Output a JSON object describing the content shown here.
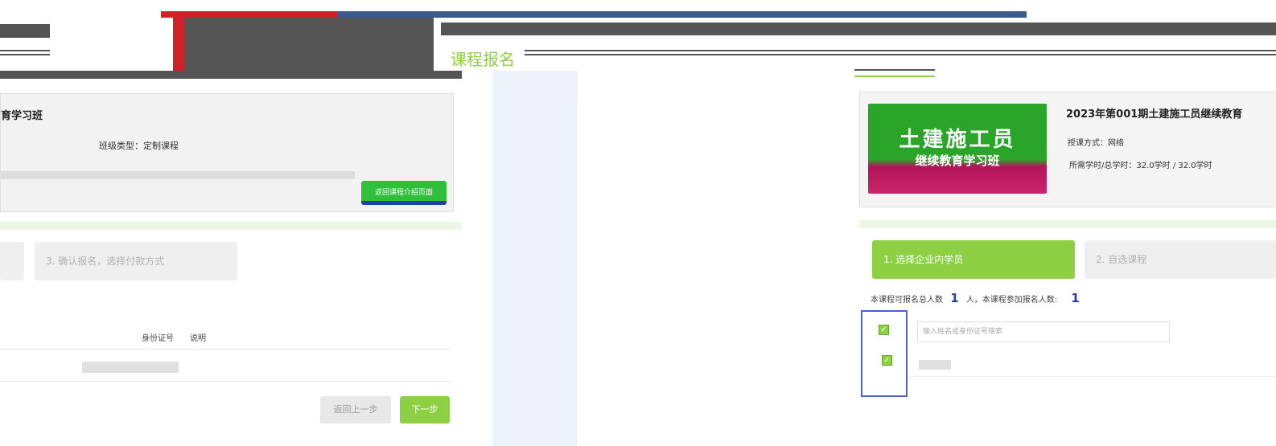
{
  "window_title": "课程报名",
  "left_panel": {
    "class_title_fragment": "育学习班",
    "class_type_label": "班级类型：定制课程",
    "back_to_intro_button": "返回课程介绍页面",
    "step3_label": "3. 确认报名，选择付款方式",
    "table_headers": [
      "身份证号",
      "说明"
    ],
    "back_button": "返回上一步",
    "next_button": "下一步"
  },
  "right_panel": {
    "banner_line1": "土建施工员",
    "banner_line2": "继续教育学习班",
    "course_title": "2023年第001期土建施工员继续教育",
    "teaching_mode": "授课方式：网络",
    "hours_info": "所需学时/总学时：32.0学时 / 32.0学时",
    "step1_label": "1. 选择企业内学员",
    "step2_label": "2. 自选课程",
    "enroll_total_label": "本课程可报名总人数",
    "enroll_total_value": "1",
    "enroll_unit": "人，本课程参加报名人数:",
    "enroll_joined_value": "1",
    "search_placeholder": "输入姓名或身份证号搜索",
    "checkbox_mark": "✓"
  },
  "colors": {
    "accent_green": "#8dd043",
    "accent_blue": "#1f3fae",
    "red_bar": "#d0202a",
    "blue_bar": "#3a5a8c"
  }
}
